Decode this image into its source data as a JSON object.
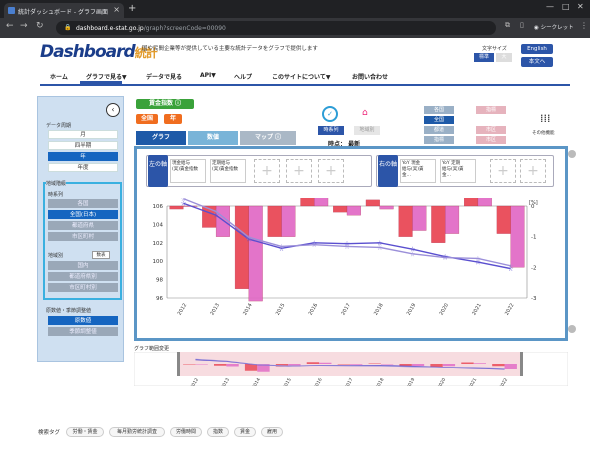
{
  "browser": {
    "tab_title": "統計ダッシュボード - グラフ画面",
    "url_host": "dashboard.e-stat.go.jp",
    "url_path": "/graph?screenCode=00090",
    "profile": "シークレット"
  },
  "header": {
    "logo": "Dashboard",
    "logo_jp": "統計",
    "tagline": "国や民間企業等が提供している主要な統計データをグラフで提供します",
    "font_size_label": "文字サイズ",
    "font_standard": "標準",
    "font_large": "大",
    "lang_english": "English",
    "lang_honbun": "本文へ"
  },
  "nav": {
    "home": "ホーム",
    "graph": "グラフで見る▼",
    "data": "データで見る",
    "api": "API▼",
    "help": "ヘルプ",
    "about": "このサイトについて▼",
    "contact": "お問い合わせ"
  },
  "left": {
    "period_label": "データ周期",
    "periods": [
      "月",
      "四半期",
      "年",
      "年度"
    ],
    "region_label": "地域階級",
    "timeseries_label": "時系列",
    "ts_items": [
      "各国",
      "全国(日本)",
      "都道府県",
      "市区町村"
    ],
    "regional_label": "地域別",
    "display_btn": "数表",
    "reg_items": [
      "国内",
      "都道府県別",
      "市区町村別"
    ],
    "adjust_label": "原数値・季節調整値",
    "adjust_items": [
      "原数値",
      "季節調整値"
    ]
  },
  "main": {
    "indicator_title": "賃金指数",
    "badge_national": "全国",
    "badge_year": "年",
    "tab_graph": "グラフ",
    "tab_values": "数値",
    "tab_map": "マップ",
    "view_timeseries": "時系列",
    "view_regional": "地域別",
    "timepoint_label": "時点：",
    "timepoint_value": "最新",
    "regions": [
      "各国",
      "指標",
      "全国",
      "都道",
      "市区",
      "指標",
      "市区",
      "市区"
    ],
    "other_label": "その他機能"
  },
  "axes": {
    "left_label": "左の軸",
    "right_label": "右の軸",
    "left_cards": [
      "現金給与\n(実)賃金指数",
      "定期給与\n(実)賃金指数"
    ],
    "right_cards": [
      "YoY 現金\n給与(実)賃\n金…",
      "YoY 定期\n給与(実)賃\n金…"
    ]
  },
  "chart_data": {
    "type": "bar+line",
    "categories": [
      "2012",
      "2013",
      "2014",
      "2015",
      "2016",
      "2017",
      "2018",
      "2019",
      "2020",
      "2021",
      "2022"
    ],
    "ylim_left": [
      96,
      106
    ],
    "ylim_right": [
      -3,
      0
    ],
    "ylabel_right": "[%]",
    "series": [
      {
        "name": "現金給与(実)賃金指数",
        "axis": "left",
        "kind": "line",
        "color": "#5a4fcf",
        "values": [
          106.3,
          105.0,
          102.4,
          101.4,
          102.0,
          101.9,
          102.0,
          101.3,
          100.5,
          99.9,
          99.2
        ]
      },
      {
        "name": "定期給与(実)賃金指数",
        "axis": "left",
        "kind": "line",
        "color": "#9b8fd9",
        "values": [
          106.8,
          105.4,
          102.6,
          101.6,
          101.8,
          101.6,
          101.5,
          100.8,
          100.4,
          100.3,
          99.5
        ]
      },
      {
        "name": "YoY 現金給与(実)賃金",
        "axis": "right",
        "kind": "bar",
        "color": "#e8404e",
        "values": [
          -0.1,
          -0.7,
          -2.7,
          -1.0,
          0.7,
          -0.2,
          0.2,
          -1.0,
          -1.2,
          0.6,
          -0.9
        ]
      },
      {
        "name": "YoY 定期給与(実)賃金",
        "axis": "right",
        "kind": "bar",
        "color": "#e066c4",
        "values": [
          0.0,
          -1.0,
          -3.1,
          -1.0,
          0.5,
          -0.3,
          -0.1,
          -0.8,
          -0.9,
          0.3,
          -2.0
        ]
      }
    ],
    "yticks_left": [
      96,
      98,
      100,
      102,
      104,
      106
    ],
    "yticks_right": [
      0,
      -1,
      -2,
      -3
    ]
  },
  "range_label": "グラフ範囲変更",
  "search_tags_label": "検索タグ",
  "search_tags": [
    "労働・賃金",
    "毎月勤労統計調査",
    "労働時間",
    "指数",
    "賃金",
    "雇用"
  ]
}
